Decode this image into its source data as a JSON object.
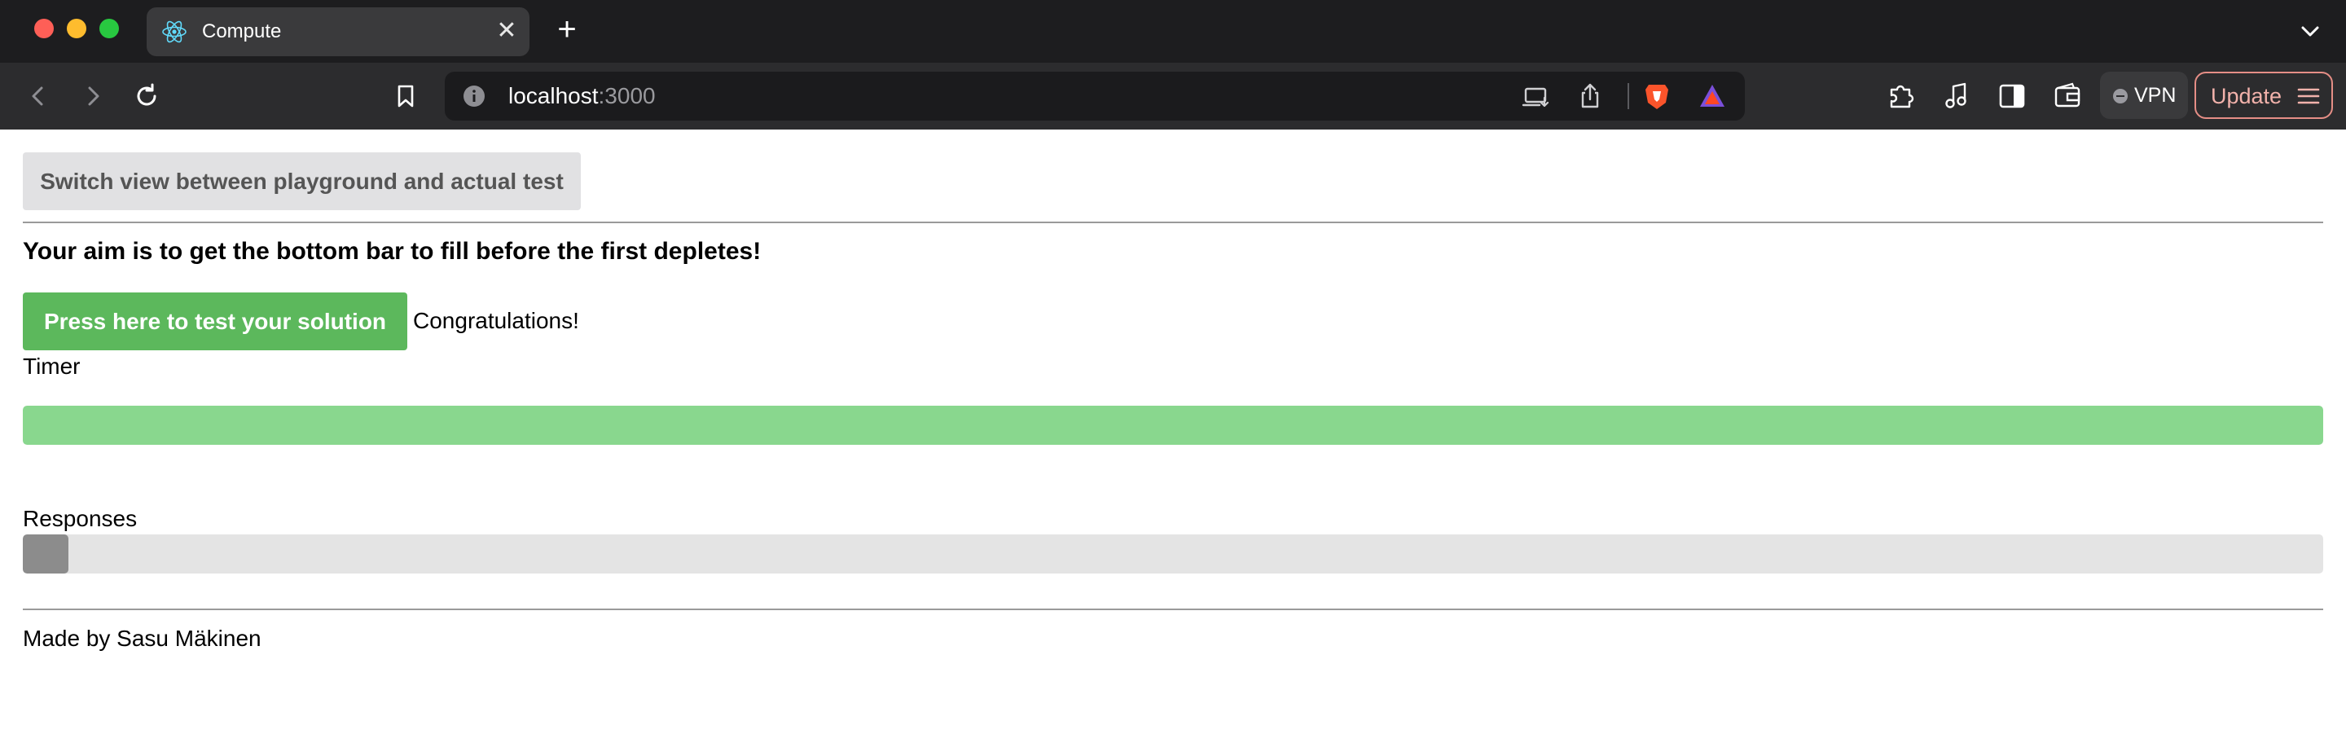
{
  "browser": {
    "tab": {
      "title": "Compute",
      "favicon": "react-logo-icon",
      "close_glyph": "✕"
    },
    "new_tab_glyph": "+",
    "url": {
      "host": "localhost",
      "port": ":3000"
    },
    "vpn_label": "VPN",
    "update_label": "Update"
  },
  "page": {
    "switch_button_label": "Switch view between playground and actual test",
    "aim_text": "Your aim is to get the bottom bar to fill before the first depletes!",
    "test_button_label": "Press here to test your solution",
    "result_text": "Congratulations!",
    "timer_label": "Timer",
    "timer_progress_percent": 100,
    "responses_label": "Responses",
    "responses_progress_percent": 2,
    "footer_text": "Made by Sasu Mäkinen",
    "colors": {
      "timer_fill": "#89d78e",
      "responses_fill": "#8c8c8c",
      "test_button": "#5cb85c",
      "switch_button": "#e1e1e3"
    }
  }
}
